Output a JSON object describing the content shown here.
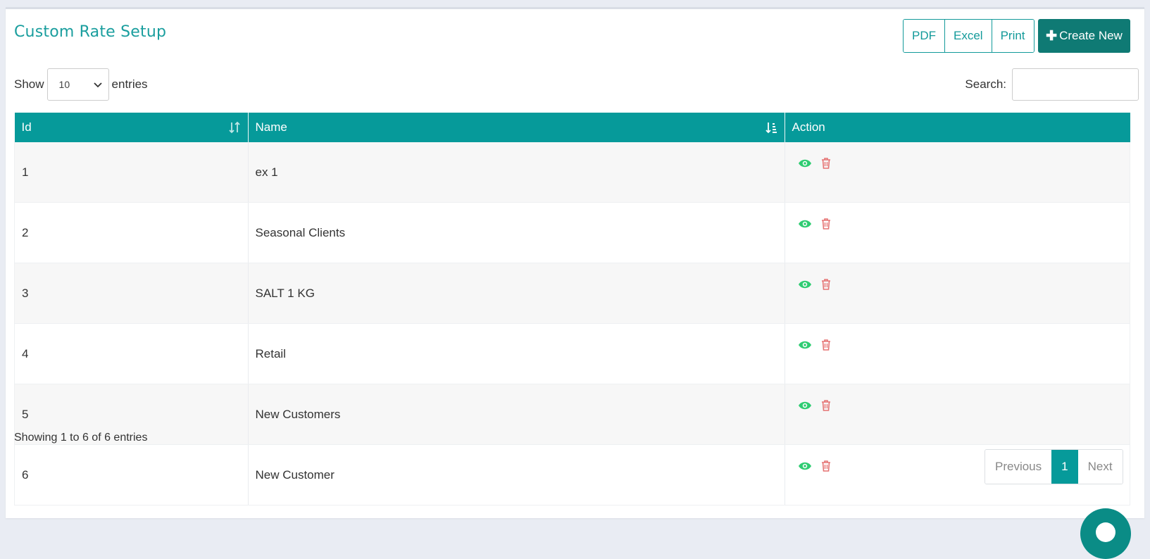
{
  "page": {
    "title": "Custom Rate Setup"
  },
  "toolbar": {
    "pdf": "PDF",
    "excel": "Excel",
    "print": "Print",
    "create_new": "Create New"
  },
  "length": {
    "show": "Show",
    "value": "10",
    "entries": "entries"
  },
  "search": {
    "label": "Search:",
    "value": ""
  },
  "table": {
    "columns": [
      "Id",
      "Name",
      "Action"
    ],
    "rows": [
      {
        "id": "1",
        "name": "ex 1"
      },
      {
        "id": "2",
        "name": "Seasonal Clients"
      },
      {
        "id": "3",
        "name": "SALT 1 KG"
      },
      {
        "id": "4",
        "name": "Retail"
      },
      {
        "id": "5",
        "name": "New Customers"
      },
      {
        "id": "6",
        "name": "New Customer"
      }
    ]
  },
  "info": "Showing 1 to 6 of 6 entries",
  "pagination": {
    "previous": "Previous",
    "current": "1",
    "next": "Next"
  },
  "colors": {
    "accent": "#069a9a",
    "create_button": "#0f7a74",
    "view_icon": "#2ecc71",
    "delete_icon": "#e57373"
  },
  "icons": {
    "view": "eye-icon",
    "delete": "trash-icon",
    "sort_both": "sort-both-icon",
    "sort_asc": "sort-asc-icon",
    "dropdown": "chevron-down-icon"
  }
}
